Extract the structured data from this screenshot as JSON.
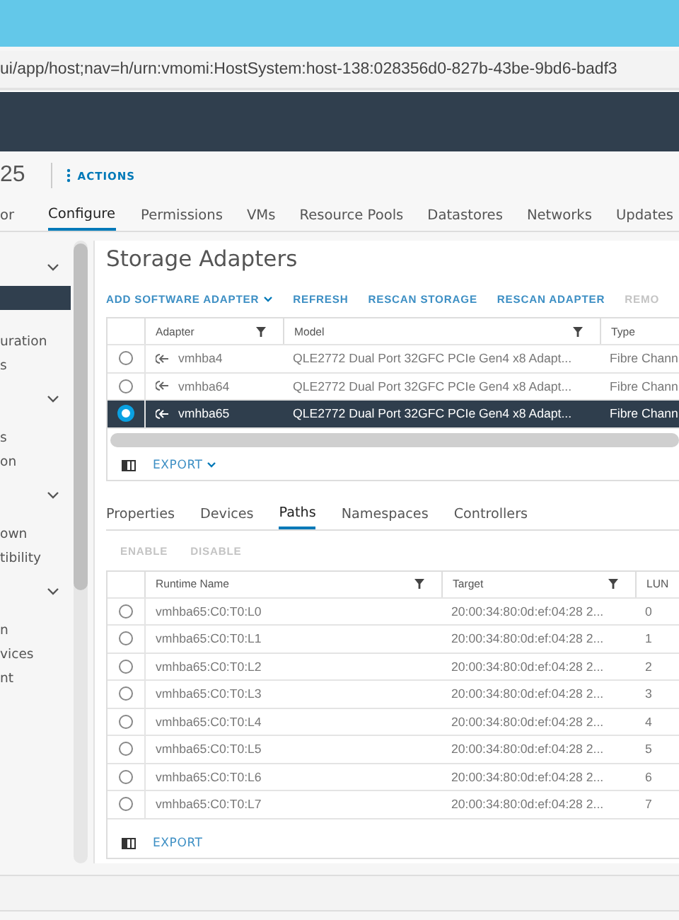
{
  "browser": {
    "url": "ui/app/host;nav=h/urn:vmomi:HostSystem:host-138:028356d0-827b-43be-9bd6-badf3"
  },
  "object_header": {
    "title": "25",
    "actions": "ACTIONS"
  },
  "tabs": [
    {
      "label": "or",
      "selected": false
    },
    {
      "label": "Configure",
      "selected": true
    },
    {
      "label": "Permissions",
      "selected": false
    },
    {
      "label": "VMs",
      "selected": false
    },
    {
      "label": "Resource Pools",
      "selected": false
    },
    {
      "label": "Datastores",
      "selected": false
    },
    {
      "label": "Networks",
      "selected": false
    },
    {
      "label": "Updates",
      "selected": false
    }
  ],
  "sidebar": {
    "items": [
      {
        "kind": "group",
        "expanded": true
      },
      {
        "kind": "item",
        "selected": true
      },
      {
        "kind": "item",
        "label": "uration",
        "selected": false
      },
      {
        "kind": "item",
        "label": "s",
        "selected": false
      },
      {
        "kind": "group",
        "expanded": true
      },
      {
        "kind": "item",
        "label": "s",
        "selected": false
      },
      {
        "kind": "item",
        "label": "on",
        "selected": false
      },
      {
        "kind": "group",
        "expanded": true
      },
      {
        "kind": "item",
        "label": "own",
        "selected": false
      },
      {
        "kind": "item",
        "label": "tibility",
        "selected": false
      },
      {
        "kind": "group",
        "expanded": true
      },
      {
        "kind": "item",
        "label": "n",
        "selected": false
      },
      {
        "kind": "item",
        "label": "vices",
        "selected": false
      },
      {
        "kind": "item",
        "label": "nt",
        "selected": false
      }
    ]
  },
  "storage_adapters": {
    "title": "Storage Adapters",
    "toolbar": [
      {
        "label": "ADD SOFTWARE ADAPTER",
        "dropdown": true,
        "disabled": false
      },
      {
        "label": "REFRESH",
        "dropdown": false,
        "disabled": false
      },
      {
        "label": "RESCAN STORAGE",
        "dropdown": false,
        "disabled": false
      },
      {
        "label": "RESCAN ADAPTER",
        "dropdown": false,
        "disabled": false
      },
      {
        "label": "REMO",
        "dropdown": false,
        "disabled": true
      }
    ],
    "columns": [
      {
        "label": "Adapter",
        "filter": true
      },
      {
        "label": "Model",
        "filter": true
      },
      {
        "label": "Type"
      }
    ],
    "rows": [
      {
        "selected": false,
        "cells": [
          "vmhba4",
          "QLE2772 Dual Port 32GFC PCIe Gen4 x8 Adapt...",
          "Fibre Chann"
        ]
      },
      {
        "selected": false,
        "cells": [
          "vmhba64",
          "QLE2772 Dual Port 32GFC PCIe Gen4 x8 Adapt...",
          "Fibre Chann"
        ]
      },
      {
        "selected": true,
        "cells": [
          "vmhba65",
          "QLE2772 Dual Port 32GFC PCIe Gen4 x8 Adapt...",
          "Fibre Chann"
        ]
      }
    ],
    "export": {
      "label": "EXPORT",
      "dropdown": true
    }
  },
  "detail_tabs": [
    {
      "label": "Properties",
      "selected": false
    },
    {
      "label": "Devices",
      "selected": false
    },
    {
      "label": "Paths",
      "selected": true
    },
    {
      "label": "Namespaces",
      "selected": false
    },
    {
      "label": "Controllers",
      "selected": false
    }
  ],
  "paths": {
    "toolbar": [
      {
        "label": "ENABLE",
        "disabled": true
      },
      {
        "label": "DISABLE",
        "disabled": true
      }
    ],
    "columns": [
      {
        "label": "Runtime Name",
        "filter": true
      },
      {
        "label": "Target",
        "filter": true
      },
      {
        "label": "LUN"
      }
    ],
    "rows": [
      {
        "selected": false,
        "cells": [
          "vmhba65:C0:T0:L0",
          "20:00:34:80:0d:ef:04:28 2...",
          "0"
        ]
      },
      {
        "selected": false,
        "cells": [
          "vmhba65:C0:T0:L1",
          "20:00:34:80:0d:ef:04:28 2...",
          "1"
        ]
      },
      {
        "selected": false,
        "cells": [
          "vmhba65:C0:T0:L2",
          "20:00:34:80:0d:ef:04:28 2...",
          "2"
        ]
      },
      {
        "selected": false,
        "cells": [
          "vmhba65:C0:T0:L3",
          "20:00:34:80:0d:ef:04:28 2...",
          "3"
        ]
      },
      {
        "selected": false,
        "cells": [
          "vmhba65:C0:T0:L4",
          "20:00:34:80:0d:ef:04:28 2...",
          "4"
        ]
      },
      {
        "selected": false,
        "cells": [
          "vmhba65:C0:T0:L5",
          "20:00:34:80:0d:ef:04:28 2...",
          "5"
        ]
      },
      {
        "selected": false,
        "cells": [
          "vmhba65:C0:T0:L6",
          "20:00:34:80:0d:ef:04:28 2...",
          "6"
        ]
      },
      {
        "selected": false,
        "cells": [
          "vmhba65:C0:T0:L7",
          "20:00:34:80:0d:ef:04:28 2...",
          "7"
        ]
      }
    ],
    "export": {
      "label": "EXPORT",
      "dropdown": false
    }
  }
}
